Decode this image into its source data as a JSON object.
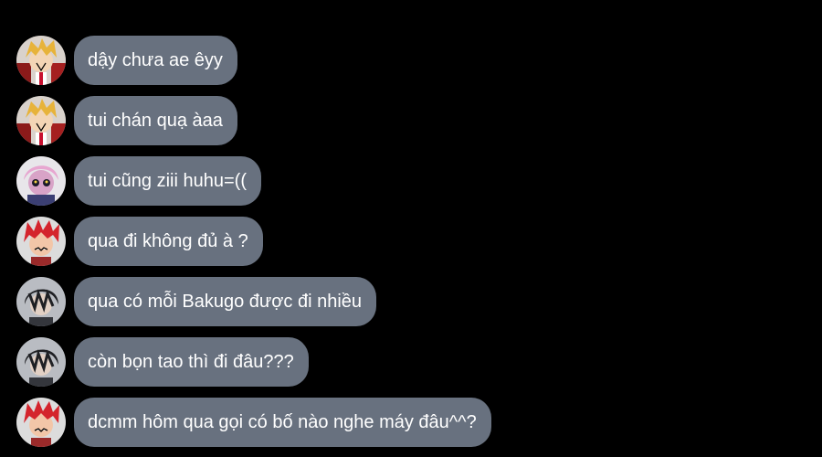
{
  "colors": {
    "background": "#000000",
    "bubble": "#68717f",
    "bubble_text": "#ffffff"
  },
  "messages": [
    {
      "avatar": "blonde-boy-avatar",
      "text": "dậy chưa ae êyy"
    },
    {
      "avatar": "blonde-boy-avatar",
      "text": "tui chán quạ àaa"
    },
    {
      "avatar": "pink-hair-girl-avatar",
      "text": "tui cũng ziii huhu=(("
    },
    {
      "avatar": "red-hair-boy-avatar",
      "text": "qua đi không đủ à ?"
    },
    {
      "avatar": "dark-hair-boy-avatar",
      "text": "qua có mỗi Bakugo được đi nhiều"
    },
    {
      "avatar": "dark-hair-boy-avatar",
      "text": "còn bọn tao thì đi đâu???"
    },
    {
      "avatar": "red-hair-boy-avatar",
      "text": "dcmm hôm qua gọi có bố nào nghe máy đâu^^?"
    }
  ]
}
